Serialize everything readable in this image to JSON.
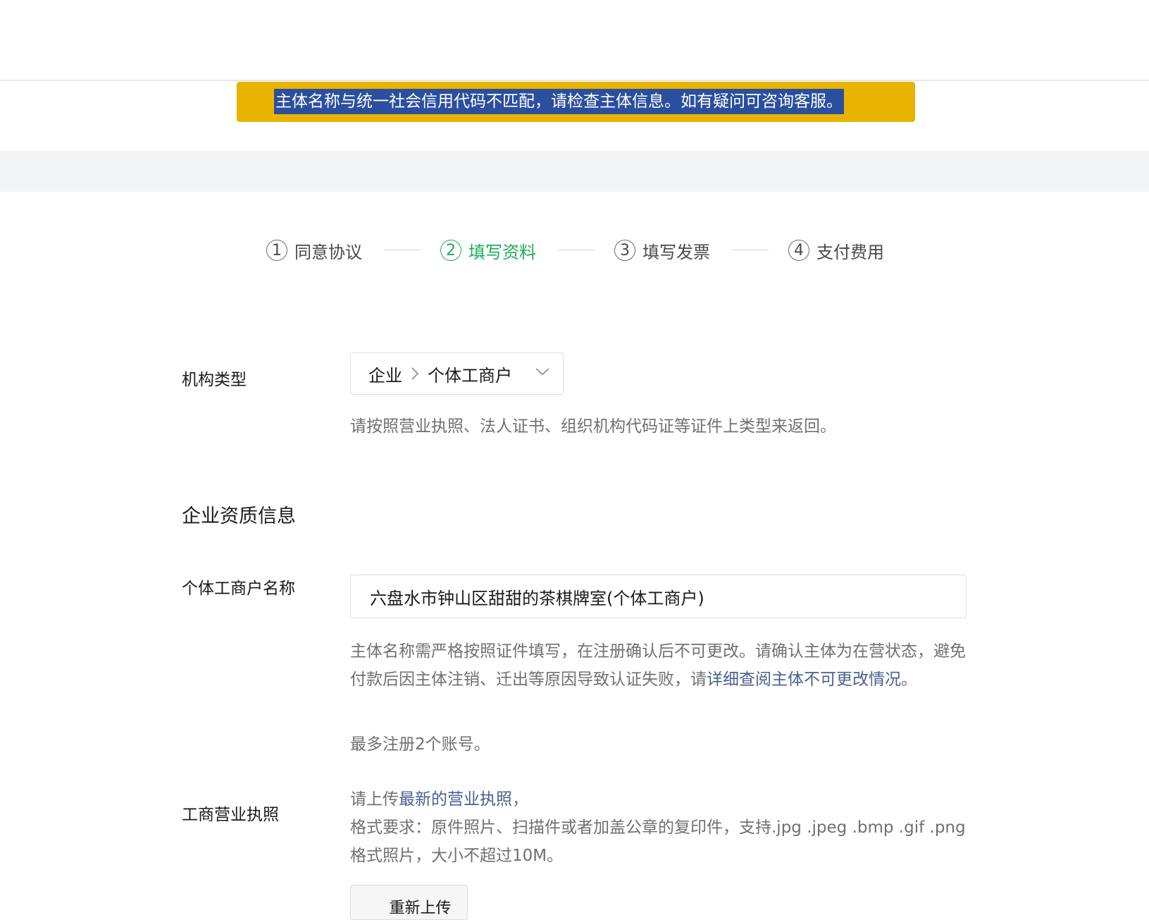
{
  "alert": {
    "message": "主体名称与统一社会信用代码不匹配，请检查主体信息。如有疑问可咨询客服。"
  },
  "steps": [
    {
      "num": "1",
      "label": "同意协议",
      "active": false
    },
    {
      "num": "2",
      "label": "填写资料",
      "active": true
    },
    {
      "num": "3",
      "label": "填写发票",
      "active": false
    },
    {
      "num": "4",
      "label": "支付费用",
      "active": false
    }
  ],
  "org_type": {
    "label": "机构类型",
    "level1": "企业",
    "level2": "个体工商户",
    "hint": "请按照营业执照、法人证书、组织机构代码证等证件上类型来返回。"
  },
  "section": {
    "title": "企业资质信息"
  },
  "business_name": {
    "label": "个体工商户名称",
    "value": "六盘水市钟山区甜甜的茶棋牌室(个体工商户)",
    "hint_part1": "主体名称需严格按照证件填写，在注册确认后不可更改。请确认主体为在营状态，避免付款后因主体注销、迁出等原因导致认证失败，请",
    "hint_link": "详细查阅主体不可更改情况",
    "hint_part2": "。",
    "limit_hint": "最多注册2个账号。"
  },
  "license": {
    "label": "工商营业执照",
    "hint_prefix": "请上传",
    "hint_link": "最新的营业执照",
    "hint_suffix": "，",
    "format_hint": "格式要求：原件照片、扫描件或者加盖公章的复印件，支持.jpg .jpeg .bmp .gif .png格式照片，大小不超过10M。",
    "upload_label": "重新上传"
  },
  "colors": {
    "alert_bg": "#e9b400",
    "alert_highlight": "#2b4f9e",
    "active_step": "#1aad5a",
    "link": "#4a5f8f"
  }
}
